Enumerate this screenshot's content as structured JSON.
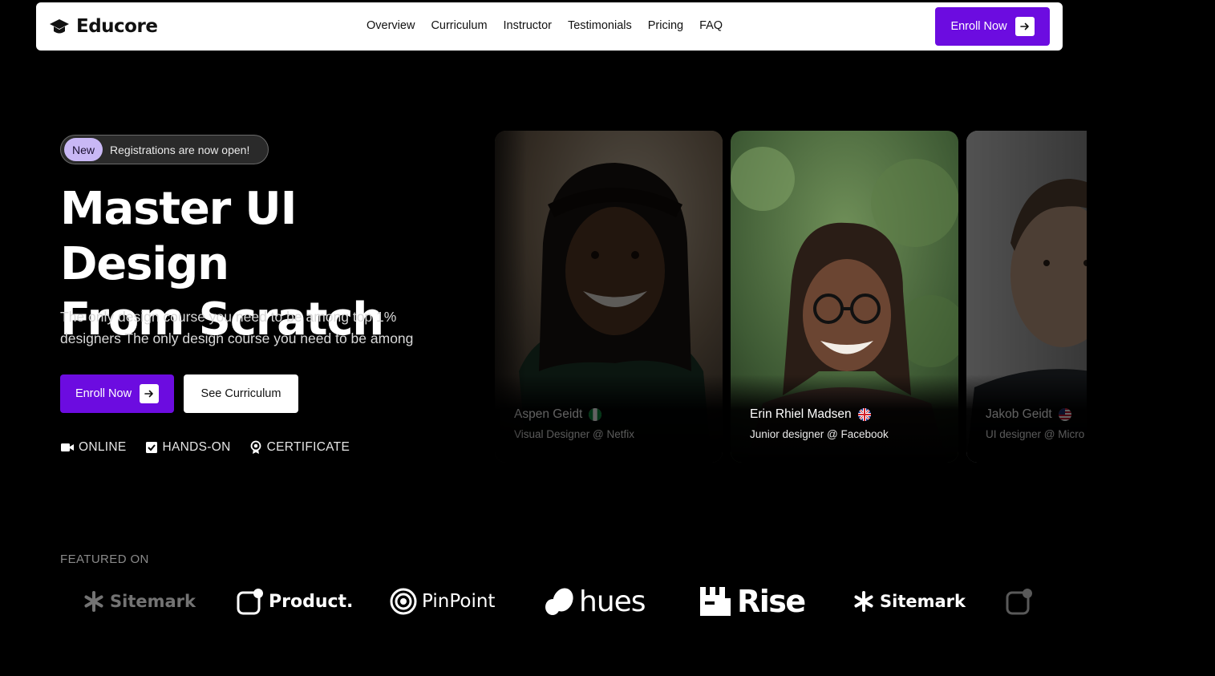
{
  "nav": {
    "brand": "Educore",
    "links": [
      "Overview",
      "Curriculum",
      "Instructor",
      "Testimonials",
      "Pricing",
      "FAQ"
    ],
    "cta": "Enroll Now"
  },
  "hero": {
    "badge_new": "New",
    "badge_text": "Registrations are now open!",
    "title_line1": "Master UI Design",
    "title_line2": "From Scratch",
    "subtitle": "The only design course you need to be among top 1% designers The only design course you need to be among",
    "primary_button": "Enroll Now",
    "secondary_button": "See Curriculum",
    "features": [
      {
        "label": "ONLINE",
        "icon": "video-camera-icon"
      },
      {
        "label": "HANDS-ON",
        "icon": "checkbox-icon"
      },
      {
        "label": "CERTIFICATE",
        "icon": "award-ribbon-icon"
      }
    ]
  },
  "testimonials": [
    {
      "name": "Aspen Geidt",
      "role": "Visual Designer @ Netfix",
      "flag": "nigeria-flag-icon",
      "state": "inactive"
    },
    {
      "name": "Erin Rhiel Madsen",
      "role": "Junior designer @ Facebook",
      "flag": "uk-flag-icon",
      "state": "active"
    },
    {
      "name": "Jakob Geidt",
      "role": "UI designer @ Micro",
      "flag": "us-flag-icon",
      "state": "inactive"
    }
  ],
  "featured": {
    "label": "FEATURED ON",
    "logos": [
      "Sitemark",
      "Product.",
      "PinPoint",
      "hues",
      "Rise",
      "Sitemark"
    ]
  },
  "colors": {
    "accent": "#6c0ce0",
    "background": "#000000",
    "badge_new": "#c9b8f5"
  }
}
